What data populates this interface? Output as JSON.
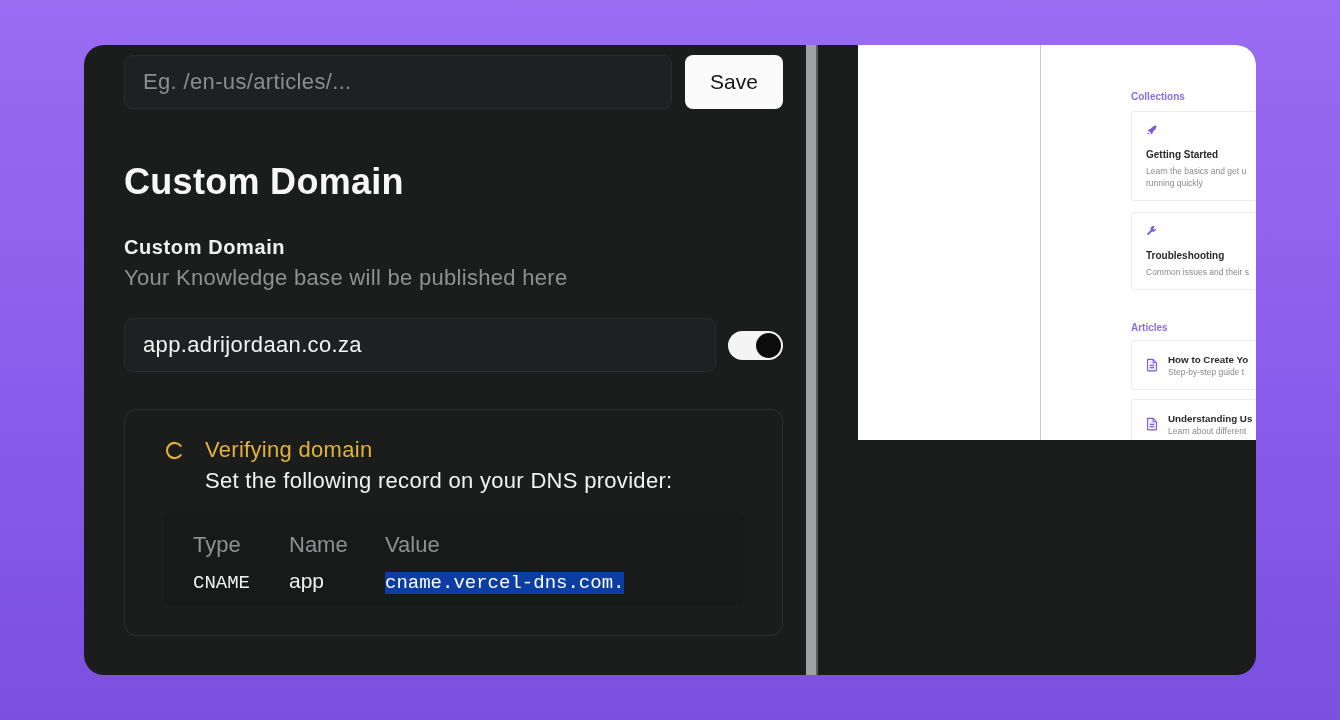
{
  "url_form": {
    "placeholder": "Eg. /en-us/articles/...",
    "button": "Save"
  },
  "custom_domain": {
    "heading": "Custom Domain",
    "label": "Custom Domain",
    "description": "Your Knowledge base will be published here",
    "value": "app.adrijordaan.co.za",
    "enabled": true
  },
  "verification": {
    "pending": true,
    "title": "Verifying domain",
    "instruction": "Set the following record on your DNS provider:",
    "columns": [
      "Type",
      "Name",
      "Value"
    ],
    "records": [
      {
        "type": "CNAME",
        "name": "app",
        "value": "cname.vercel-dns.com.",
        "value_highlighted": true
      }
    ]
  },
  "preview": {
    "collections_heading": "Collections",
    "collections": [
      {
        "title": "Getting Started",
        "description_lines": [
          "Learn the basics and get u",
          "running quickly"
        ]
      },
      {
        "title": "Troubleshooting",
        "description_lines": [
          "Common issues and their s"
        ]
      }
    ],
    "articles_heading": "Articles",
    "articles": [
      {
        "title": "How to Create Yo",
        "description": "Step-by-step guide t"
      },
      {
        "title": "Understanding Us",
        "description": "Learn about different"
      }
    ]
  }
}
